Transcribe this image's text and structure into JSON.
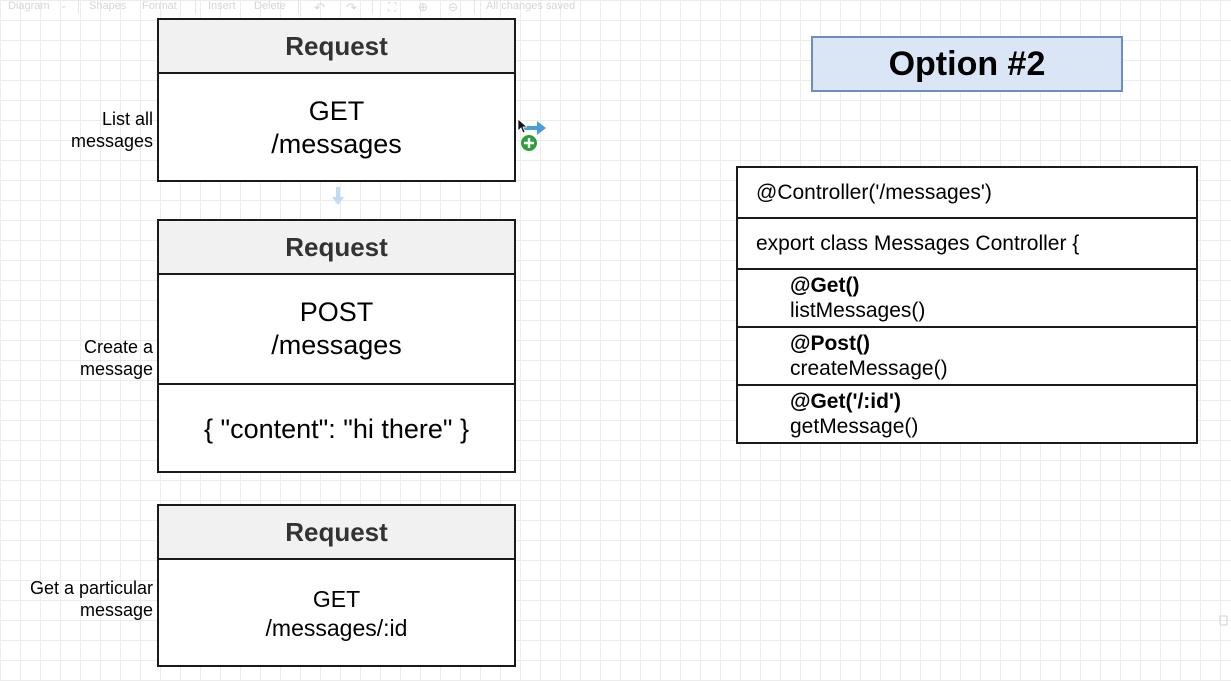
{
  "toolbar": {
    "diagram": "Diagram",
    "shapes": "Shapes",
    "format": "Format",
    "insert": "Insert",
    "delete": "Delete",
    "status": "All changes saved"
  },
  "requests": [
    {
      "header": "Request",
      "label_line1": "List all",
      "label_line2": "messages",
      "method": "GET",
      "path": "/messages"
    },
    {
      "header": "Request",
      "label_line1": "Create a",
      "label_line2": "message",
      "method": "POST",
      "path": "/messages",
      "body": "{ \"content\": \"hi there\" }"
    },
    {
      "header": "Request",
      "label_line1": "Get a particular",
      "label_line2": "message",
      "method": "GET",
      "path": "/messages/:id"
    }
  ],
  "option": {
    "title": "Option #2"
  },
  "controller": {
    "decorator": "@Controller('/messages')",
    "class_line": "export class Messages Controller {",
    "methods": [
      {
        "decorator": "@Get()",
        "name": "listMessages()"
      },
      {
        "decorator": "@Post()",
        "name": "createMessage()"
      },
      {
        "decorator": "@Get('/:id')",
        "name": "getMessage()"
      }
    ]
  },
  "colors": {
    "option_fill": "#dae6f6",
    "option_border": "#6c8ebf",
    "header_fill": "#f1f1f1",
    "connector_blue": "#4a9fd8",
    "add_green": "#2e9e3a"
  }
}
